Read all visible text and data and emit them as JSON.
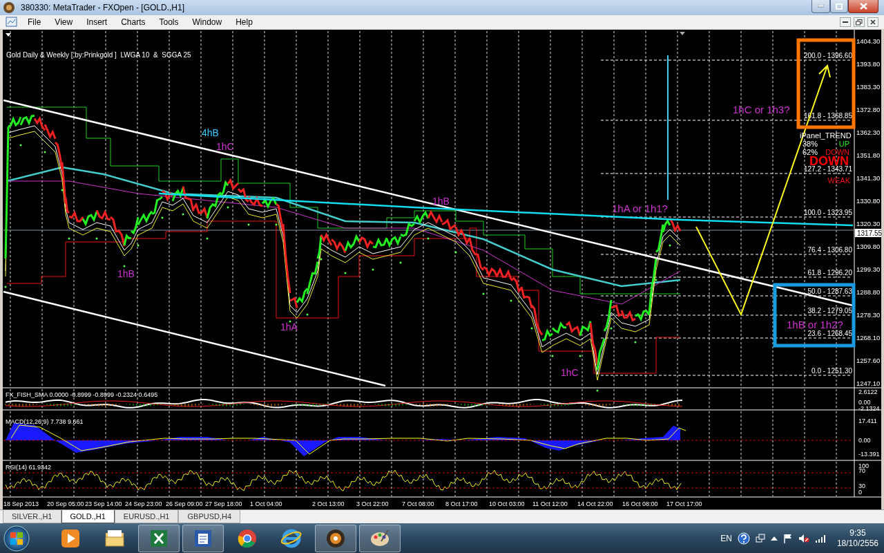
{
  "window": {
    "title": "380330: MetaTrader - FXOpen - [GOLD.,H1]"
  },
  "menu": [
    "File",
    "View",
    "Insert",
    "Charts",
    "Tools",
    "Window",
    "Help"
  ],
  "chart": {
    "title": "Gold Daily & Weekly [ by:Prinkgold ]  LWGA 10  &  SGGA 25",
    "price_axis": [
      "1404.30",
      "1393.80",
      "1383.30",
      "1372.80",
      "1362.30",
      "1351.80",
      "1341.30",
      "1330.80",
      "1320.30",
      "1309.80",
      "1299.30",
      "1288.80",
      "1278.30",
      "1268.10",
      "1257.60",
      "1247.10"
    ],
    "current_price": "1317.55",
    "fib_levels": [
      "200.0 - 1396.60",
      "161.8 - 1368.85",
      "127.2 - 1343.71",
      "100.0 - 1323.95",
      "76.4 - 1306.80",
      "61.8 - 1296.20",
      "50.0 - 1287.63",
      "38.2 - 1279.05",
      "23.6 - 1268.45",
      "0.0 - 1251.30"
    ],
    "wave_labels": [
      {
        "text": "4hB",
        "color": "#33ccff"
      },
      {
        "text": "1hC",
        "color": "#cc33cc"
      },
      {
        "text": "1hB",
        "color": "#cc33cc"
      },
      {
        "text": "1hA",
        "color": "#cc33cc"
      },
      {
        "text": "1hB",
        "color": "#cc33cc"
      },
      {
        "text": "1hA or 1h1?",
        "color": "#cc33cc"
      },
      {
        "text": "1hC",
        "color": "#cc33cc"
      },
      {
        "text": "1hC or 1h3?",
        "color": "#cc33cc"
      },
      {
        "text": "1hB or 1h2?",
        "color": "#cc33cc"
      }
    ],
    "trend_panel": {
      "title": "iPanel_TREND",
      "rows": [
        {
          "percent": "38%",
          "label": "UP",
          "kind": "up"
        },
        {
          "percent": "62%",
          "label": "DOWN",
          "kind": "down"
        }
      ],
      "signal": "DOWN",
      "strength": "WEAK"
    }
  },
  "indicators": [
    {
      "label": "FX_FISH_SMA 0.0000 -0.8999 -0.8999 -0.2324 0.6495",
      "axis": [
        "2.6122",
        "0.00",
        "-2.1324"
      ]
    },
    {
      "label": "MACD(12,26,9) 7.738 9.661",
      "axis": [
        "17.411",
        "0.00",
        "-13.391"
      ]
    },
    {
      "label": "RSI(14) 61.9342",
      "axis": [
        "100",
        "70",
        "30",
        "0"
      ]
    }
  ],
  "time_axis": [
    "18 Sep 2013",
    "20 Sep 05:00",
    "23 Sep 14:00",
    "24 Sep 23:00",
    "26 Sep 09:00",
    "27 Sep 18:00",
    "1 Oct 04:00",
    "2 Oct 13:00",
    "3 Oct 22:00",
    "7 Oct 08:00",
    "8 Oct 17:00",
    "10 Oct 03:00",
    "11 Oct 12:00",
    "14 Oct 22:00",
    "16 Oct 08:00",
    "17 Oct 17:00"
  ],
  "tabs": [
    {
      "label": "SILVER.,H1",
      "selected": false
    },
    {
      "label": "GOLD.,H1",
      "selected": true
    },
    {
      "label": "EURUSD.,H1",
      "selected": false
    },
    {
      "label": "GBPUSD,H4",
      "selected": false
    }
  ],
  "taskbar": {
    "apps": [
      {
        "running": false
      },
      {
        "running": false
      },
      {
        "running": true
      },
      {
        "running": true
      },
      {
        "running": false
      },
      {
        "running": false
      },
      {
        "running": true
      },
      {
        "running": true
      }
    ],
    "language": "EN",
    "time": "9:35",
    "date": "18/10/2556"
  }
}
